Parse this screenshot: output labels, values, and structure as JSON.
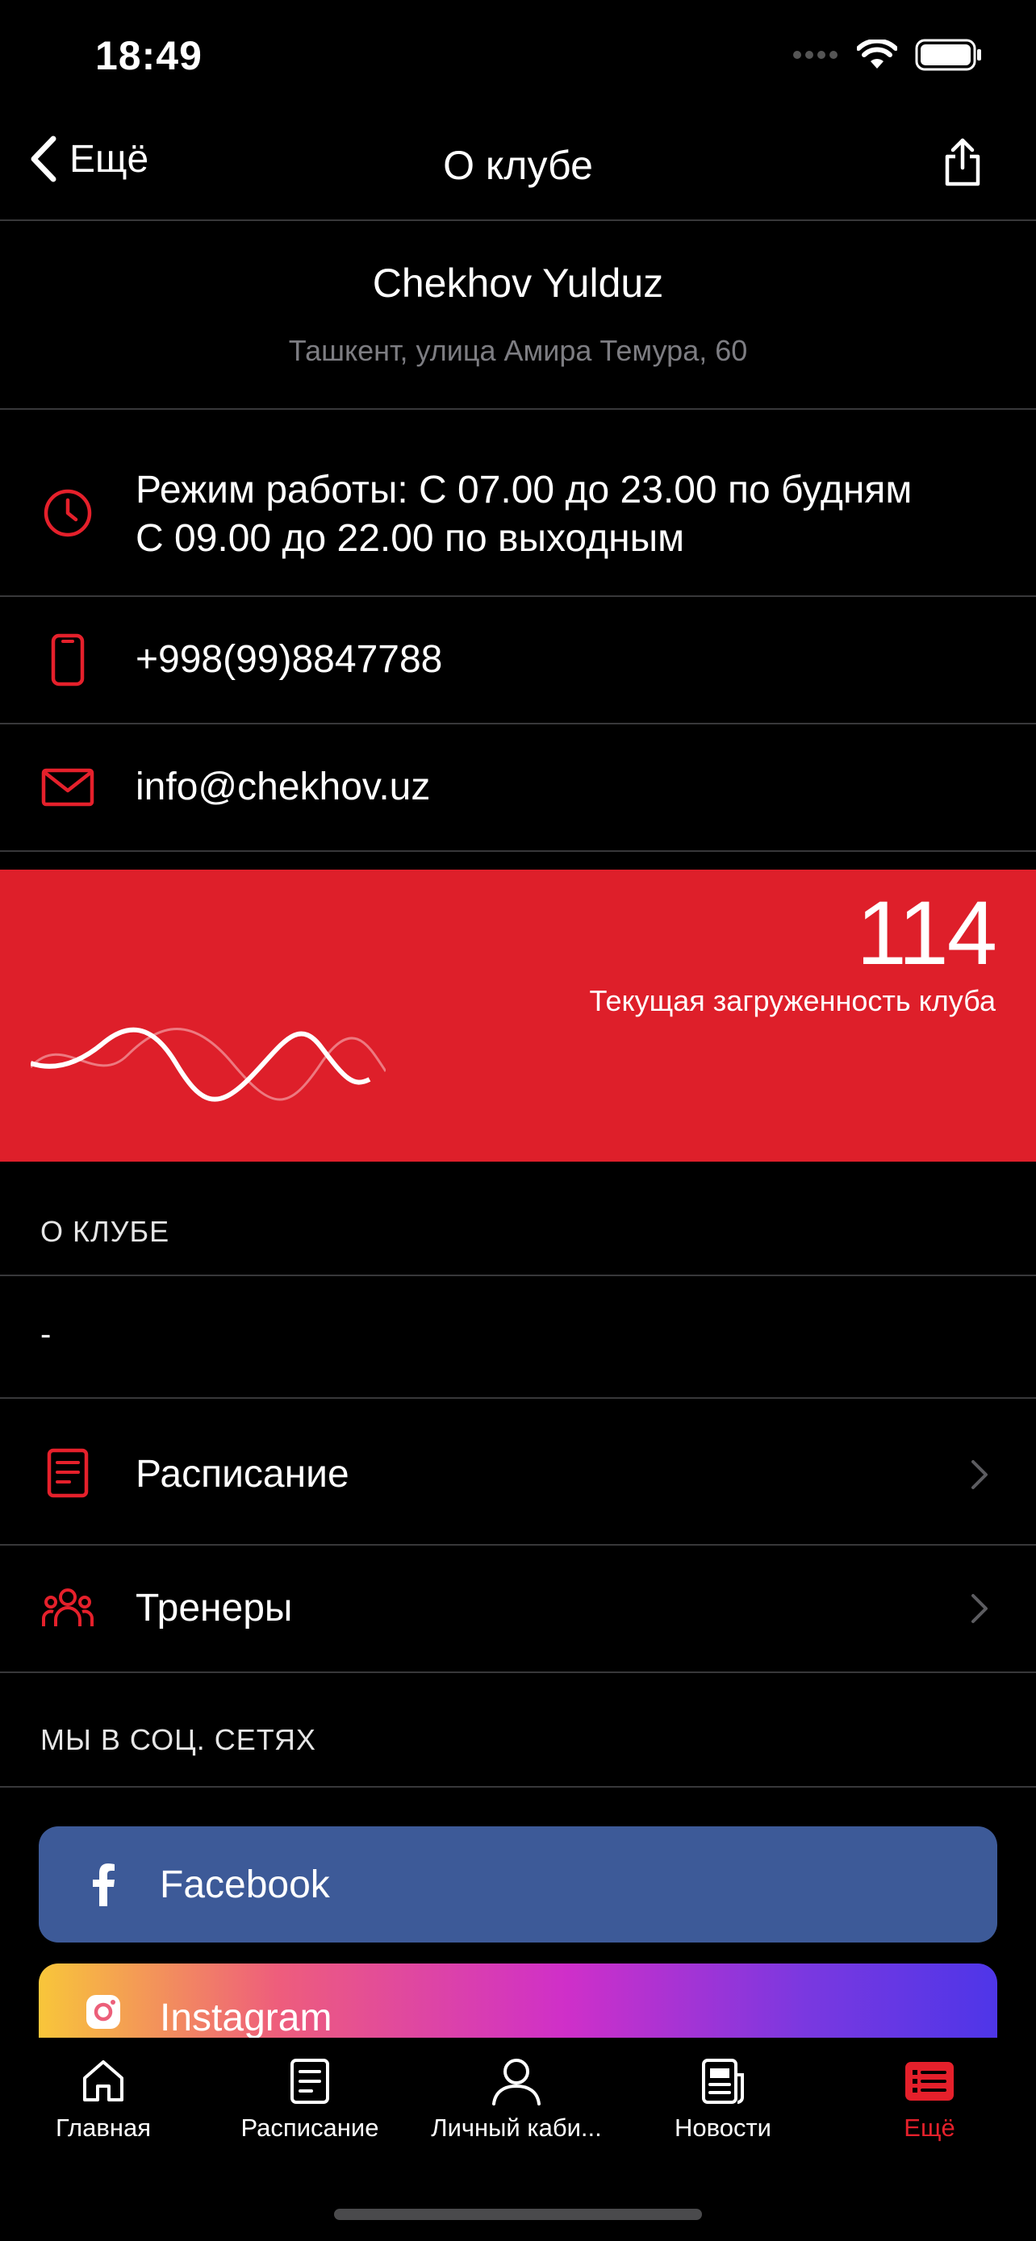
{
  "status_bar": {
    "time": "18:49"
  },
  "nav": {
    "back_label": "Ещё",
    "title": "О клубе"
  },
  "club": {
    "name": "Chekhov Yulduz",
    "address": "Ташкент, улица Амира Темура, 60"
  },
  "info": {
    "hours_line1": "Режим работы: С 07.00 до 23.00 по будням",
    "hours_line2": "С 09.00 до 22.00 по выходным",
    "phone": "+998(99)8847788",
    "email": "info@chekhov.uz"
  },
  "load": {
    "value": "114",
    "label": "Текущая загруженность клуба"
  },
  "about": {
    "section_title": "О КЛУБЕ",
    "text": "-"
  },
  "links": [
    {
      "label": "Расписание",
      "icon": "document-icon"
    },
    {
      "label": "Тренеры",
      "icon": "people-icon"
    }
  ],
  "social": {
    "section_title": "МЫ В СОЦ. СЕТЯХ",
    "facebook": "Facebook",
    "instagram": "Instagram"
  },
  "tabs": [
    {
      "label": "Главная",
      "icon": "home-icon"
    },
    {
      "label": "Расписание",
      "icon": "document-icon"
    },
    {
      "label": "Личный каби...",
      "icon": "person-icon"
    },
    {
      "label": "Новости",
      "icon": "news-icon"
    },
    {
      "label": "Ещё",
      "icon": "list-icon",
      "active": true
    }
  ],
  "colors": {
    "accent": "#e5202b",
    "card_red": "#de1f2a",
    "facebook": "#3d5a98"
  }
}
